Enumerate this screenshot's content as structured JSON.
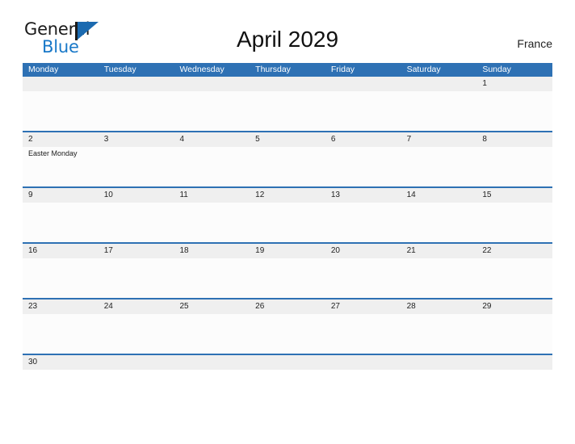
{
  "brand": {
    "name_part1": "General",
    "name_part2": "Blue",
    "logo_icon": "blue-flag-triangle",
    "color_primary": "#1878c8",
    "color_dark": "#1b1b1b"
  },
  "header": {
    "title": "April 2029",
    "country": "France"
  },
  "calendar": {
    "accent_color": "#2e71b4",
    "band_color": "#efefef",
    "weekdays": [
      "Monday",
      "Tuesday",
      "Wednesday",
      "Thursday",
      "Friday",
      "Saturday",
      "Sunday"
    ],
    "weeks": [
      {
        "clipped": false,
        "days": [
          {
            "num": "",
            "events": []
          },
          {
            "num": "",
            "events": []
          },
          {
            "num": "",
            "events": []
          },
          {
            "num": "",
            "events": []
          },
          {
            "num": "",
            "events": []
          },
          {
            "num": "",
            "events": []
          },
          {
            "num": "1",
            "events": []
          }
        ]
      },
      {
        "clipped": false,
        "days": [
          {
            "num": "2",
            "events": [
              "Easter Monday"
            ]
          },
          {
            "num": "3",
            "events": []
          },
          {
            "num": "4",
            "events": []
          },
          {
            "num": "5",
            "events": []
          },
          {
            "num": "6",
            "events": []
          },
          {
            "num": "7",
            "events": []
          },
          {
            "num": "8",
            "events": []
          }
        ]
      },
      {
        "clipped": false,
        "days": [
          {
            "num": "9",
            "events": []
          },
          {
            "num": "10",
            "events": []
          },
          {
            "num": "11",
            "events": []
          },
          {
            "num": "12",
            "events": []
          },
          {
            "num": "13",
            "events": []
          },
          {
            "num": "14",
            "events": []
          },
          {
            "num": "15",
            "events": []
          }
        ]
      },
      {
        "clipped": false,
        "days": [
          {
            "num": "16",
            "events": []
          },
          {
            "num": "17",
            "events": []
          },
          {
            "num": "18",
            "events": []
          },
          {
            "num": "19",
            "events": []
          },
          {
            "num": "20",
            "events": []
          },
          {
            "num": "21",
            "events": []
          },
          {
            "num": "22",
            "events": []
          }
        ]
      },
      {
        "clipped": false,
        "days": [
          {
            "num": "23",
            "events": []
          },
          {
            "num": "24",
            "events": []
          },
          {
            "num": "25",
            "events": []
          },
          {
            "num": "26",
            "events": []
          },
          {
            "num": "27",
            "events": []
          },
          {
            "num": "28",
            "events": []
          },
          {
            "num": "29",
            "events": []
          }
        ]
      },
      {
        "clipped": true,
        "days": [
          {
            "num": "30",
            "events": []
          },
          {
            "num": "",
            "events": []
          },
          {
            "num": "",
            "events": []
          },
          {
            "num": "",
            "events": []
          },
          {
            "num": "",
            "events": []
          },
          {
            "num": "",
            "events": []
          },
          {
            "num": "",
            "events": []
          }
        ]
      }
    ]
  }
}
